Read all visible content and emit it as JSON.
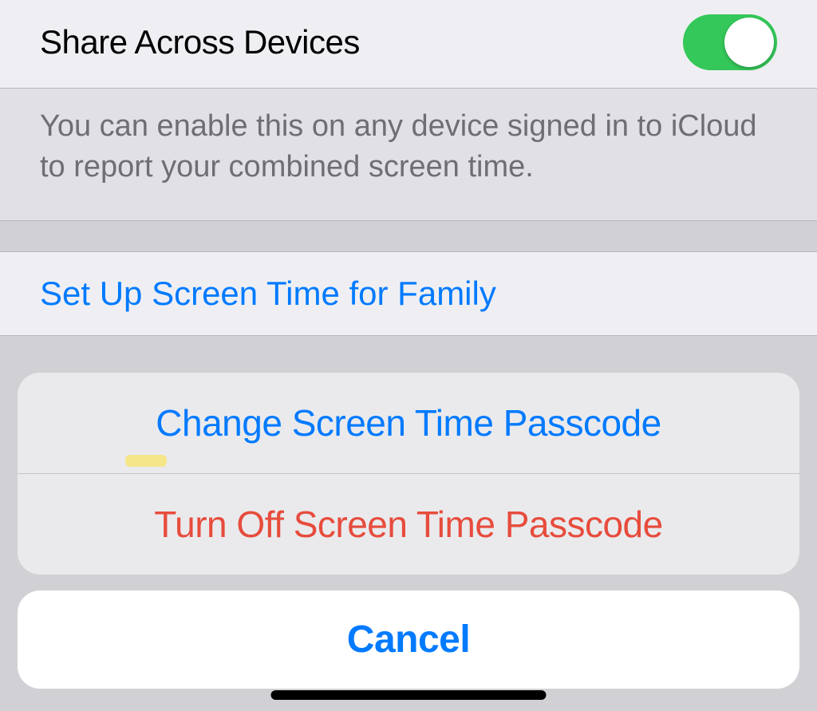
{
  "settings": {
    "shareRow": {
      "label": "Share Across Devices",
      "enabled": true
    },
    "shareFooter": "You can enable this on any device signed in to iCloud to report your combined screen time.",
    "familyRow": "Set Up Screen Time for Family"
  },
  "actionSheet": {
    "options": [
      {
        "label": "Change Screen Time Passcode",
        "style": "blue"
      },
      {
        "label": "Turn Off Screen Time Passcode",
        "style": "red"
      }
    ],
    "cancel": "Cancel"
  }
}
